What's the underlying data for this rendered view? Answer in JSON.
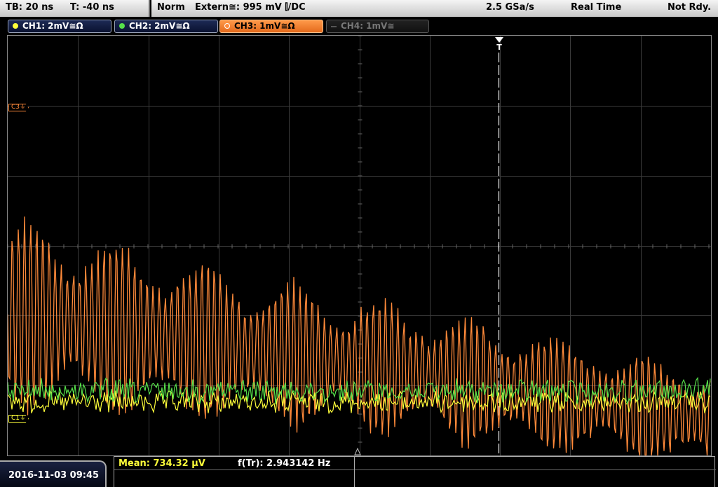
{
  "status": {
    "timebase": "TB: 20 ns",
    "trigger_time": "T: -40 ns",
    "mode": "Norm",
    "trigger_source": "Extern≅: 995 mV ⫿/DC",
    "sample_rate": "2.5 GSa/s",
    "acq_mode": "Real Time",
    "ready": "Not Rdy."
  },
  "channels": [
    {
      "label": "CH1: 2mV≅Ω",
      "color": "#ffff3a",
      "state": "on"
    },
    {
      "label": "CH2: 2mV≅Ω",
      "color": "#56e04a",
      "state": "on"
    },
    {
      "label": "CH3: 1mV≅Ω",
      "color": "#ff8a3a",
      "state": "active"
    },
    {
      "label": "CH4: 1mV≅",
      "color": "#777777",
      "state": "off"
    }
  ],
  "markers": {
    "c3": "C3",
    "c1": "C1",
    "trigger": "T"
  },
  "bottom": {
    "datetime": "2016-11-03 09:45",
    "mean_label": "Mean: 734.32 µV",
    "freq_label": "f(Tr): 2.943142 Hz"
  },
  "colors": {
    "ch1": "#ffff3a",
    "ch2": "#56e04a",
    "ch3": "#ff8a3a",
    "grid": "#3a3a3a"
  }
}
